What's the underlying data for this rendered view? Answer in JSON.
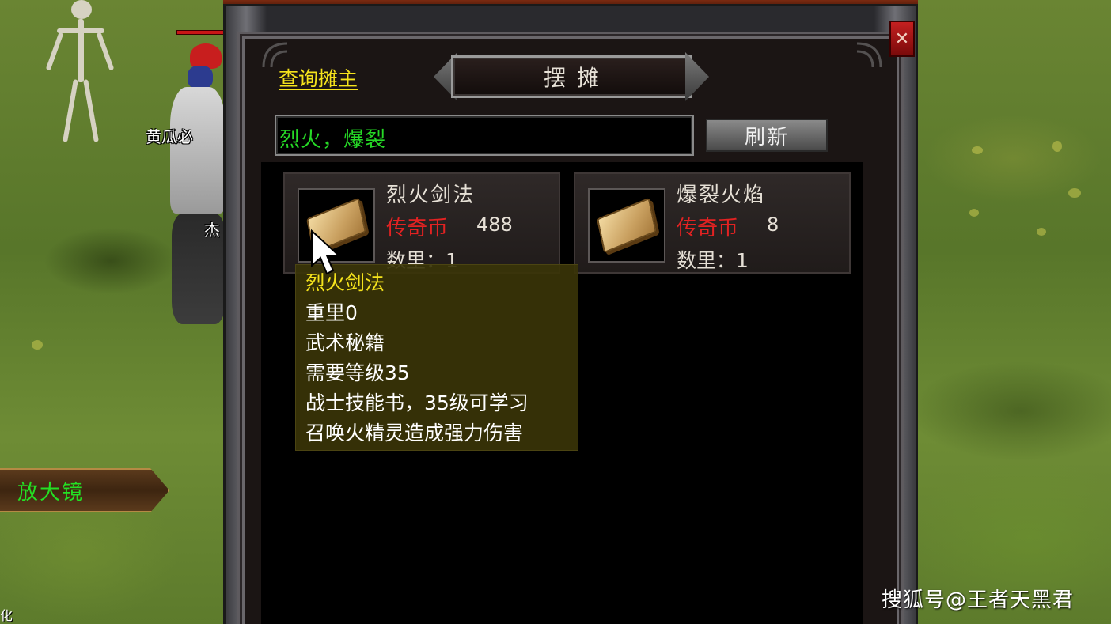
{
  "scene": {
    "player_names": [
      "黄瓜必",
      "杰",
      "化"
    ],
    "magnifier_label": "放大镜"
  },
  "window": {
    "close_label": "✕",
    "query_owner_link": "查询摊主",
    "title": "摆摊",
    "search": {
      "value": "烈火，爆裂"
    },
    "refresh_label": "刷新",
    "items": [
      {
        "name": "烈火剑法",
        "currency": "传奇币",
        "price": "488",
        "quantity": "数里：1",
        "icon": "skill-book-icon"
      },
      {
        "name": "爆裂火焰",
        "currency": "传奇币",
        "price": "8",
        "quantity": "数里：1",
        "icon": "skill-book-icon"
      }
    ],
    "tooltip": {
      "title": "烈火剑法",
      "lines": [
        "重里0",
        "武术秘籍",
        "需要等级35",
        "战士技能书，35级可学习",
        "召唤火精灵造成强力伤害"
      ]
    }
  },
  "watermark": "搜狐号@王者天黑君",
  "colors": {
    "link_yellow": "#f4e21c",
    "input_green": "#26d926",
    "currency_red": "#e32222",
    "tooltip_bg": "#3a3408"
  }
}
